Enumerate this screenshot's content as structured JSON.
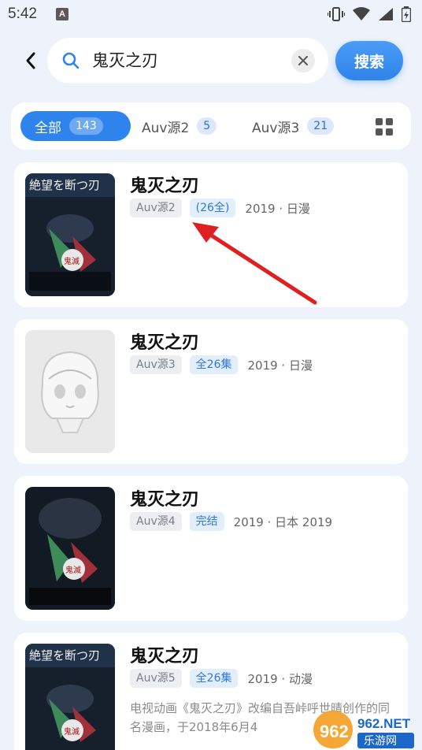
{
  "status_bar": {
    "time": "5:42",
    "app_indicator": "A"
  },
  "search": {
    "query": "鬼灭之刃",
    "button_label": "搜索"
  },
  "tabs": [
    {
      "label": "全部",
      "count": "143",
      "active": true
    },
    {
      "label": "Auv源2",
      "count": "5",
      "active": false
    },
    {
      "label": "Auv源3",
      "count": "21",
      "active": false
    }
  ],
  "results": [
    {
      "title": "鬼灭之刃",
      "source": "Auv源2",
      "episodes": "(26全)",
      "meta": "2019 · 日漫",
      "description": "",
      "poster": "dark"
    },
    {
      "title": "鬼灭之刃",
      "source": "Auv源3",
      "episodes": "全26集",
      "meta": "2019 · 日漫",
      "description": "",
      "poster": "light"
    },
    {
      "title": "鬼灭之刃",
      "source": "Auv源4",
      "episodes": "完结",
      "meta": "2019 · 日本 2019",
      "description": "",
      "poster": "dark"
    },
    {
      "title": "鬼灭之刃",
      "source": "Auv源5",
      "episodes": "全26集",
      "meta": "2019 · 动漫",
      "description": "电视动画《鬼灭之刃》改编自吾峠呼世晴创作的同名漫画，于2018年6月4",
      "poster": "dark"
    }
  ],
  "watermark": {
    "line1": "962.NET",
    "line2": "乐游网"
  },
  "colors": {
    "accent": "#2e84ec",
    "background": "#eef3fb",
    "arrow": "#e02020"
  }
}
